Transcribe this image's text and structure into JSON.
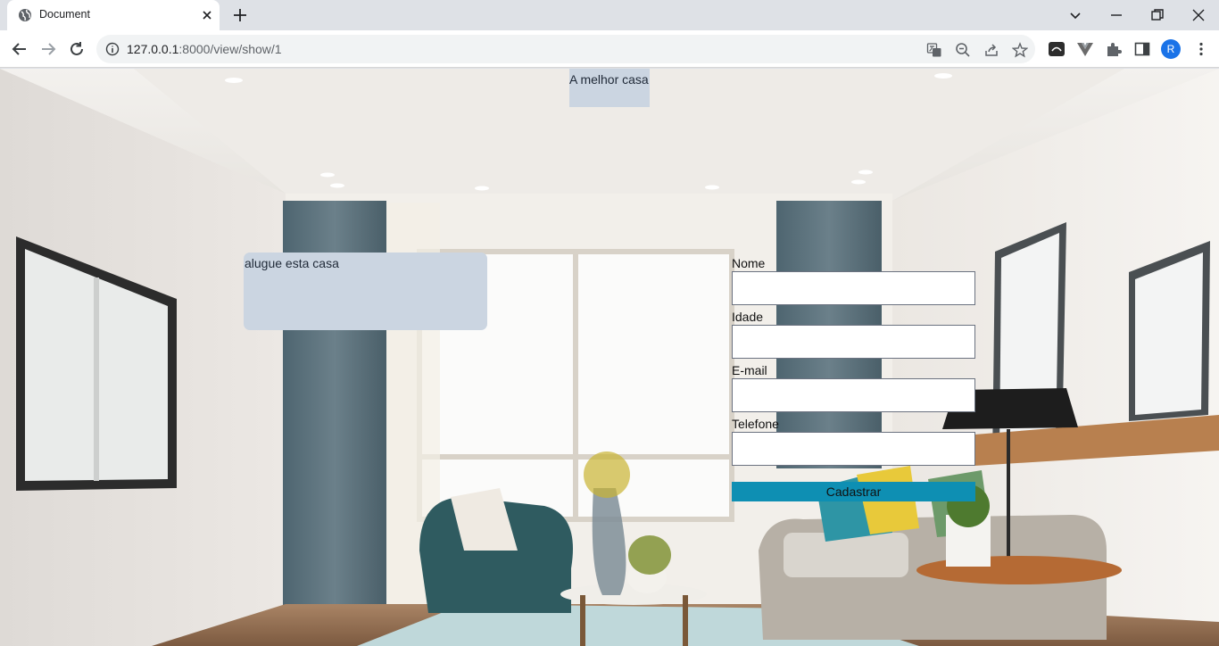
{
  "browser": {
    "tab_title": "Document",
    "url_host": "127.0.0.1",
    "url_path": ":8000/view/show/1",
    "avatar_letter": "R"
  },
  "page": {
    "header_text": "A melhor casa",
    "rent_text": "alugue esta casa",
    "form": {
      "name_label": "Nome",
      "age_label": "Idade",
      "email_label": "E-mail",
      "phone_label": "Telefone",
      "name_value": "",
      "age_value": "",
      "email_value": "",
      "phone_value": "",
      "submit_label": "Cadastrar"
    }
  },
  "colors": {
    "box_bg": "#cbd5e1",
    "button_bg": "#0e8fb3",
    "profile": "#1a73e8"
  }
}
